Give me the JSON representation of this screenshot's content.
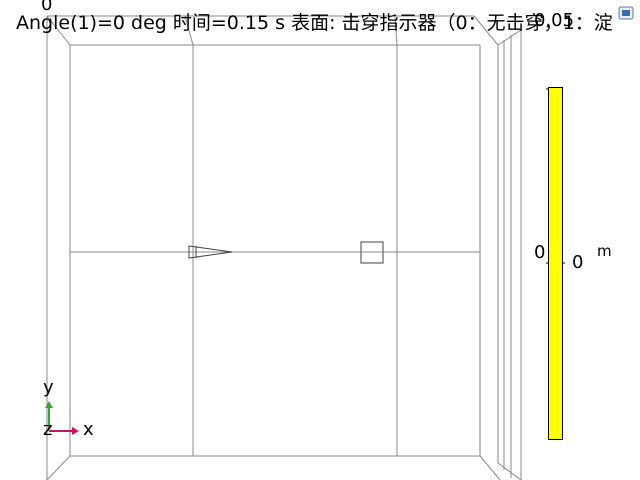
{
  "title": "Angle(1)=0 deg 时间=0.15 s  表面: 击穿指示器（0：无击穿，1：淀",
  "axis_top_tick": "0",
  "colorbar": {
    "top_label": "0.05",
    "mid_label_left": "0",
    "mid_label_right": "0",
    "unit": "m",
    "fill_color": "#ffff00"
  },
  "axes_triad": {
    "y_label": "y",
    "z_label": "z",
    "x_label": "x",
    "x_color": "#c0185a",
    "y_color": "#3aa23a"
  },
  "icons": {
    "corner": "toolbar-icon"
  }
}
